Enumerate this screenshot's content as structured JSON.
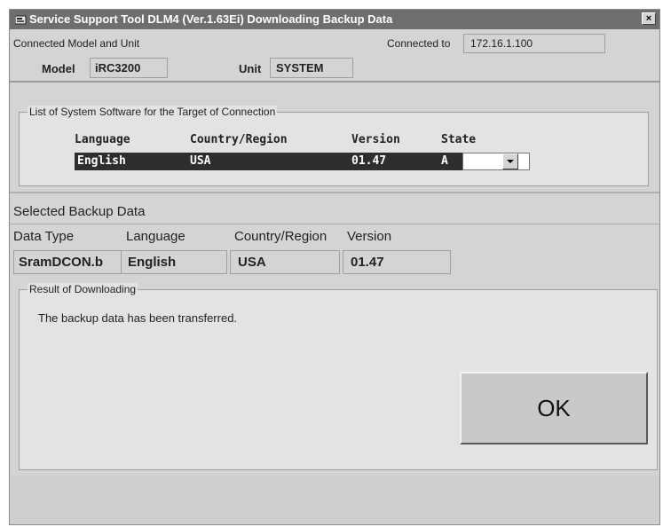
{
  "window": {
    "title": "Service Support Tool DLM4 (Ver.1.63Ei) Downloading Backup Data",
    "close_glyph": "×"
  },
  "connection": {
    "section_label": "Connected Model and Unit",
    "connected_to_label": "Connected to",
    "connected_to_value": "172.16.1.100",
    "model_label": "Model",
    "model_value": "iRC3200",
    "unit_label": "Unit",
    "unit_value": "SYSTEM"
  },
  "software_list": {
    "group_label": "List of System Software for the Target of Connection",
    "headers": [
      "Language",
      "Country/Region",
      "Version",
      "State"
    ],
    "selected_row": {
      "language": "English",
      "country": "USA",
      "version": "01.47",
      "state": "A"
    }
  },
  "backup": {
    "section_label": "Selected Backup Data",
    "headers": [
      "Data Type",
      "Language",
      "Country/Region",
      "Version"
    ],
    "values": [
      "SramDCON.b",
      "English",
      "USA",
      "01.47"
    ]
  },
  "result": {
    "group_label": "Result of Downloading",
    "message": "The backup data has been transferred.",
    "ok_label": "OK"
  }
}
